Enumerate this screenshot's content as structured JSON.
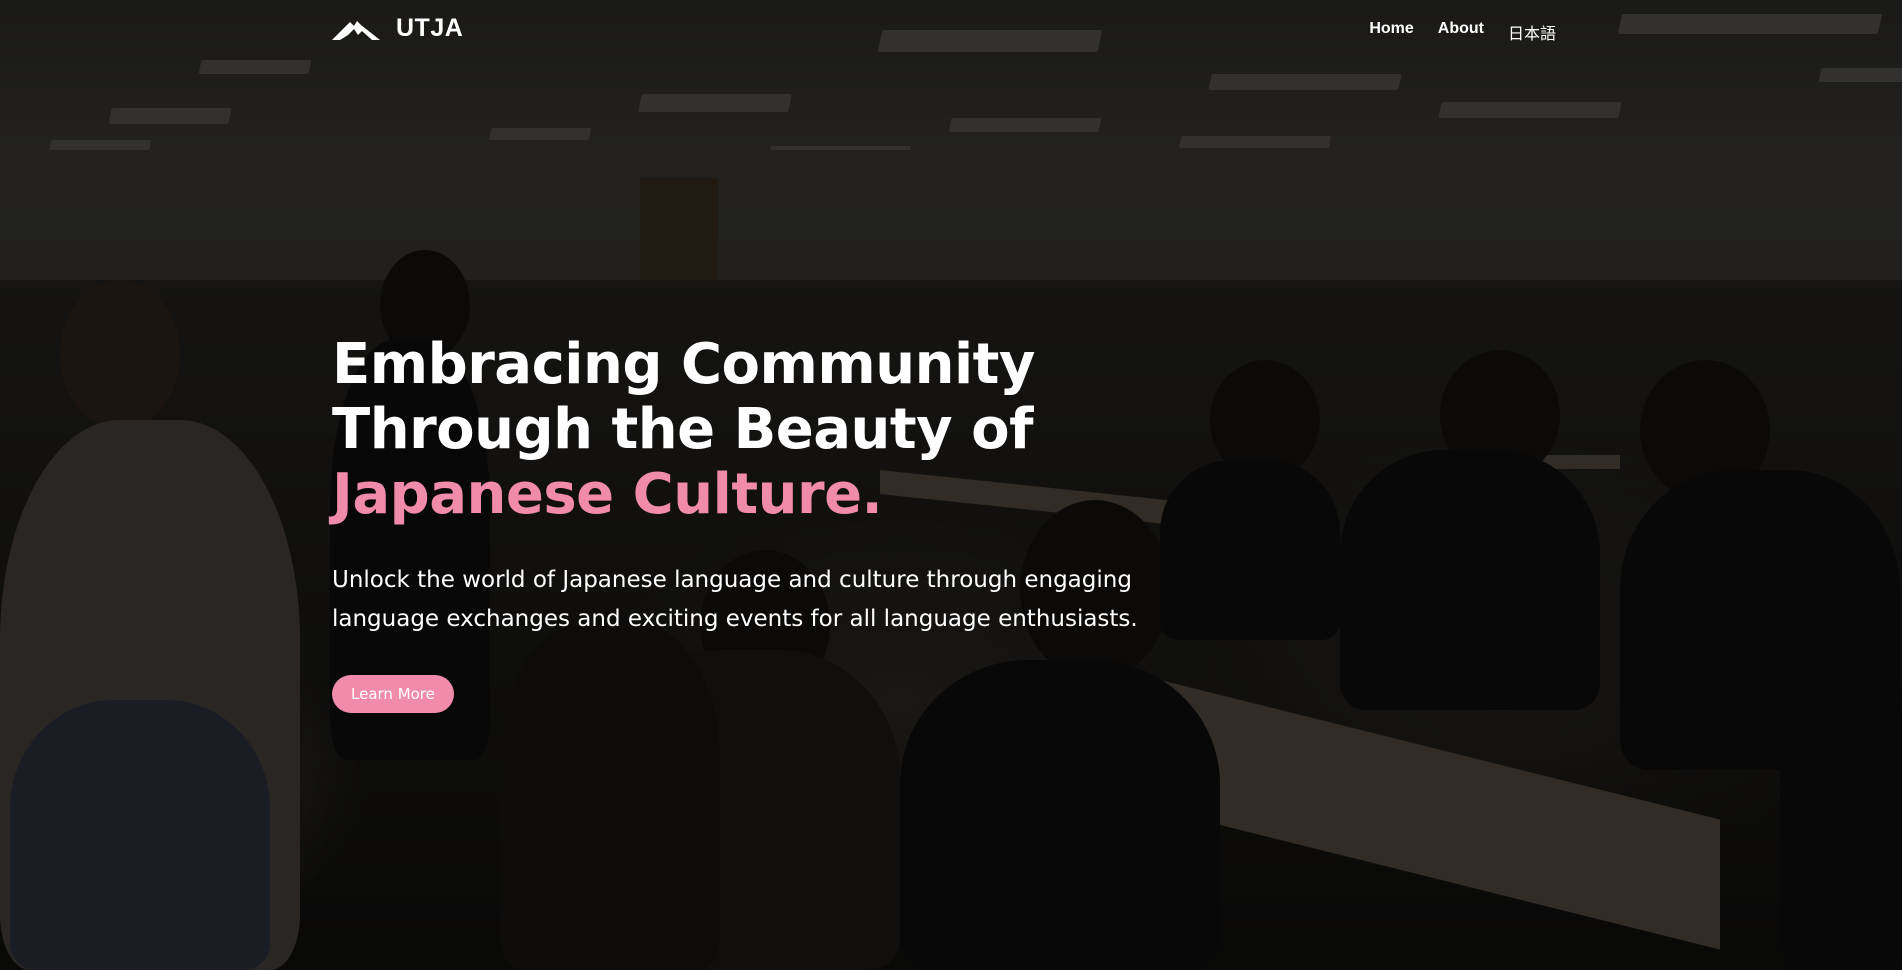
{
  "brand": {
    "name": "UTJA",
    "logo_icon": "mountain-icon"
  },
  "nav": {
    "items": [
      {
        "label": "Home"
      },
      {
        "label": "About"
      },
      {
        "label": "日本語"
      }
    ]
  },
  "hero": {
    "headline_line1": "Embracing Community",
    "headline_line2": "Through the Beauty of",
    "headline_accent": "Japanese Culture.",
    "subtitle": "Unlock the world of Japanese language and culture through engaging language exchanges and exciting events for all language enthusiasts.",
    "cta_label": "Learn More"
  },
  "colors": {
    "accent": "#f08bab",
    "text": "#ffffff"
  }
}
